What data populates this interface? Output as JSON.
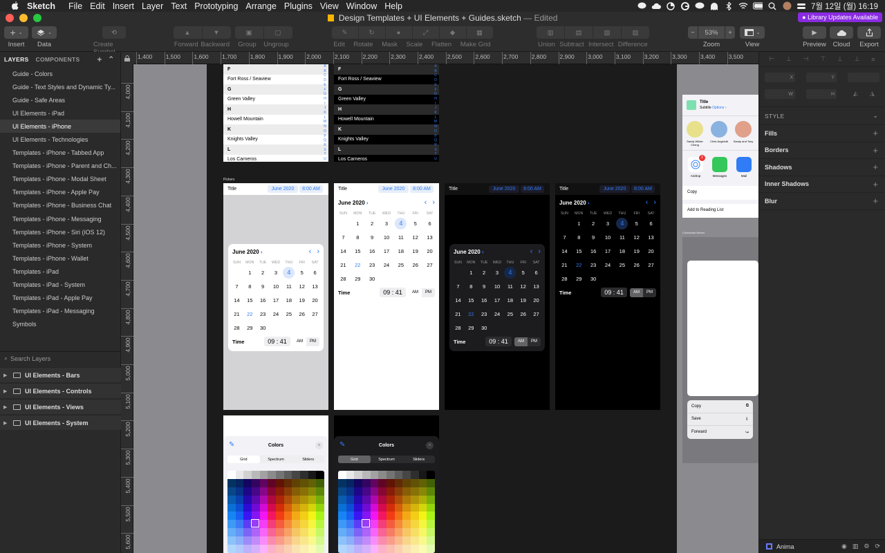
{
  "menubar": {
    "app": "Sketch",
    "items": [
      "File",
      "Edit",
      "Insert",
      "Layer",
      "Text",
      "Prototyping",
      "Arrange",
      "Plugins",
      "View",
      "Window",
      "Help"
    ],
    "clock": "7월 12일 (월)  16:19"
  },
  "window": {
    "title": "Design Templates + UI Elements + Guides.sketch",
    "edited": "— Edited",
    "library_badge": "Library Updates Available"
  },
  "toolbar": {
    "insert": "Insert",
    "data": "Data",
    "create_symbol": "Create Symbol",
    "forward": "Forward",
    "backward": "Backward",
    "group": "Group",
    "ungroup": "Ungroup",
    "edit": "Edit",
    "rotate": "Rotate",
    "mask": "Mask",
    "scale": "Scale",
    "flatten": "Flatten",
    "make_grid": "Make Grid",
    "union": "Union",
    "subtract": "Subtract",
    "intersect": "Intersect",
    "difference": "Difference",
    "zoom_label": "Zoom",
    "zoom_value": "53%",
    "view": "View",
    "preview": "Preview",
    "cloud": "Cloud",
    "export": "Export"
  },
  "left_panel": {
    "tab_layers": "LAYERS",
    "tab_components": "COMPONENTS",
    "pages": [
      "Guide - Colors",
      "Guide - Text Styles and Dynamic Ty...",
      "Guide - Safe Areas",
      "UI Elements - iPad",
      "UI Elements - iPhone",
      "UI Elements - Technologies",
      "Templates - iPhone - Tabbed App",
      "Templates - iPhone - Parent and Ch...",
      "Templates - iPhone - Modal Sheet",
      "Templates - iPhone - Apple Pay",
      "Templates - iPhone - Business Chat",
      "Templates - iPhone - Messaging",
      "Templates - iPhone - Siri (iOS 12)",
      "Templates - iPhone - System",
      "Templates - iPhone - Wallet",
      "Templates - iPad",
      "Templates - iPad - System",
      "Templates - iPad - Apple Pay",
      "Templates - iPad - Messaging",
      "Symbols"
    ],
    "selected_page": 4,
    "search_placeholder": "Search Layers",
    "layers": [
      "UI Elements - Bars",
      "UI Elements - Controls",
      "UI Elements - Views",
      "UI Elements - System"
    ]
  },
  "ruler": {
    "h": [
      "1,400",
      "1,500",
      "1,600",
      "1,700",
      "1,800",
      "1,900",
      "2,000",
      "2,100",
      "2,200",
      "2,300",
      "2,400",
      "2,500",
      "2,600",
      "2,700",
      "2,800",
      "2,900",
      "3,000",
      "3,100",
      "3,200",
      "3,300",
      "3,400",
      "3,500"
    ],
    "v": [
      "4,000",
      "4,100",
      "4,200",
      "4,300",
      "4,400",
      "4,500",
      "4,600",
      "4,700",
      "4,800",
      "4,900",
      "5,000",
      "5,100",
      "5,200",
      "5,300",
      "5,400",
      "5,500",
      "5,600"
    ]
  },
  "list_rows": [
    {
      "t": "head",
      "v": "F"
    },
    {
      "t": "row",
      "v": "Fort Ross / Seaview"
    },
    {
      "t": "head",
      "v": "G"
    },
    {
      "t": "row",
      "v": "Green Valley"
    },
    {
      "t": "head",
      "v": "H"
    },
    {
      "t": "row",
      "v": "Howell Mountain"
    },
    {
      "t": "head",
      "v": "K"
    },
    {
      "t": "row",
      "v": "Knights Valley"
    },
    {
      "t": "head",
      "v": "L"
    },
    {
      "t": "row",
      "v": "Los Carneros"
    }
  ],
  "index_letters": "ABCDEFGHIJKLMNOPQRSTUVWXYZ#",
  "pickers_label": "Pickers",
  "picker": {
    "title": "Title",
    "date_pill": "June 2020",
    "time_pill": "8:00 AM",
    "month": "June 2020",
    "dow": [
      "SUN",
      "MON",
      "TUE",
      "WED",
      "THU",
      "FRI",
      "SAT"
    ],
    "days": [
      "",
      "1",
      "2",
      "3",
      "4",
      "5",
      "6",
      "7",
      "8",
      "9",
      "10",
      "11",
      "12",
      "13",
      "14",
      "15",
      "16",
      "17",
      "18",
      "19",
      "20",
      "21",
      "22",
      "23",
      "24",
      "25",
      "26",
      "27",
      "28",
      "29",
      "30",
      "",
      "",
      "",
      ""
    ],
    "time_label": "Time",
    "time_value": "09 : 41",
    "am": "AM",
    "pm": "PM"
  },
  "colors_panel": {
    "title": "Colors",
    "tabs": [
      "Grid",
      "Spectrum",
      "Sliders"
    ]
  },
  "share_sheet": {
    "title": "Title",
    "subtitle": "Subtitle",
    "options": "Options ›",
    "contacts": [
      "Sandy Wilder Cheng",
      "Chris Angelotti",
      "Sandy and Tony"
    ],
    "apps": [
      "Airdrop",
      "Messages",
      "Mail"
    ],
    "badge": "2",
    "actions": [
      "Copy",
      "Add to Reading List"
    ]
  },
  "context_menus_label": "Contextual Menus",
  "context_menu": [
    "Copy",
    "Save",
    "Forward"
  ],
  "right_panel": {
    "style": "STYLE",
    "sections": [
      "Fills",
      "Borders",
      "Shadows",
      "Inner Shadows",
      "Blur"
    ],
    "x": "X",
    "y": "Y",
    "w": "W",
    "h": "H",
    "plugin": "Anima"
  },
  "colors": {
    "accent": "#2f7cf6",
    "badge": "#8a2be2"
  }
}
